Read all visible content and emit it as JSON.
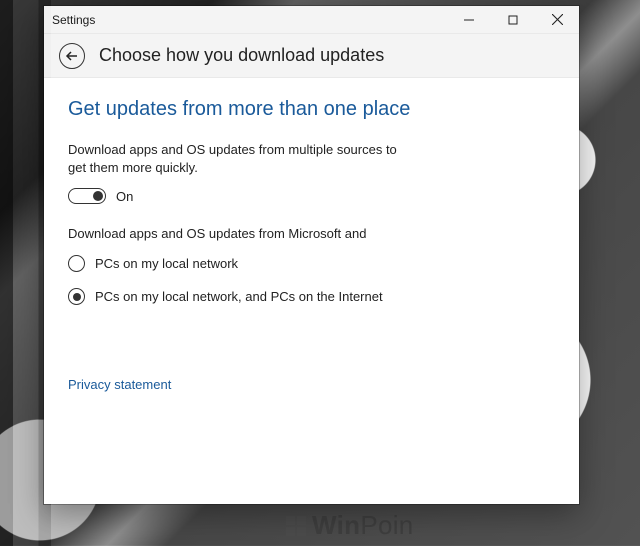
{
  "titlebar": {
    "app_title": "Settings"
  },
  "header": {
    "page_title": "Choose how you download updates"
  },
  "content": {
    "heading": "Get updates from more than one place",
    "description": "Download apps and OS updates from multiple sources to get them more quickly.",
    "toggle": {
      "state": "on",
      "label": "On"
    },
    "sub_description": "Download apps and OS updates from Microsoft and",
    "options": [
      {
        "label": "PCs on my local network",
        "selected": false
      },
      {
        "label": "PCs on my local network, and PCs on the Internet",
        "selected": true
      }
    ],
    "privacy_link": "Privacy statement"
  },
  "watermark": {
    "text_prefix": "Win",
    "text_suffix": "Poin"
  }
}
